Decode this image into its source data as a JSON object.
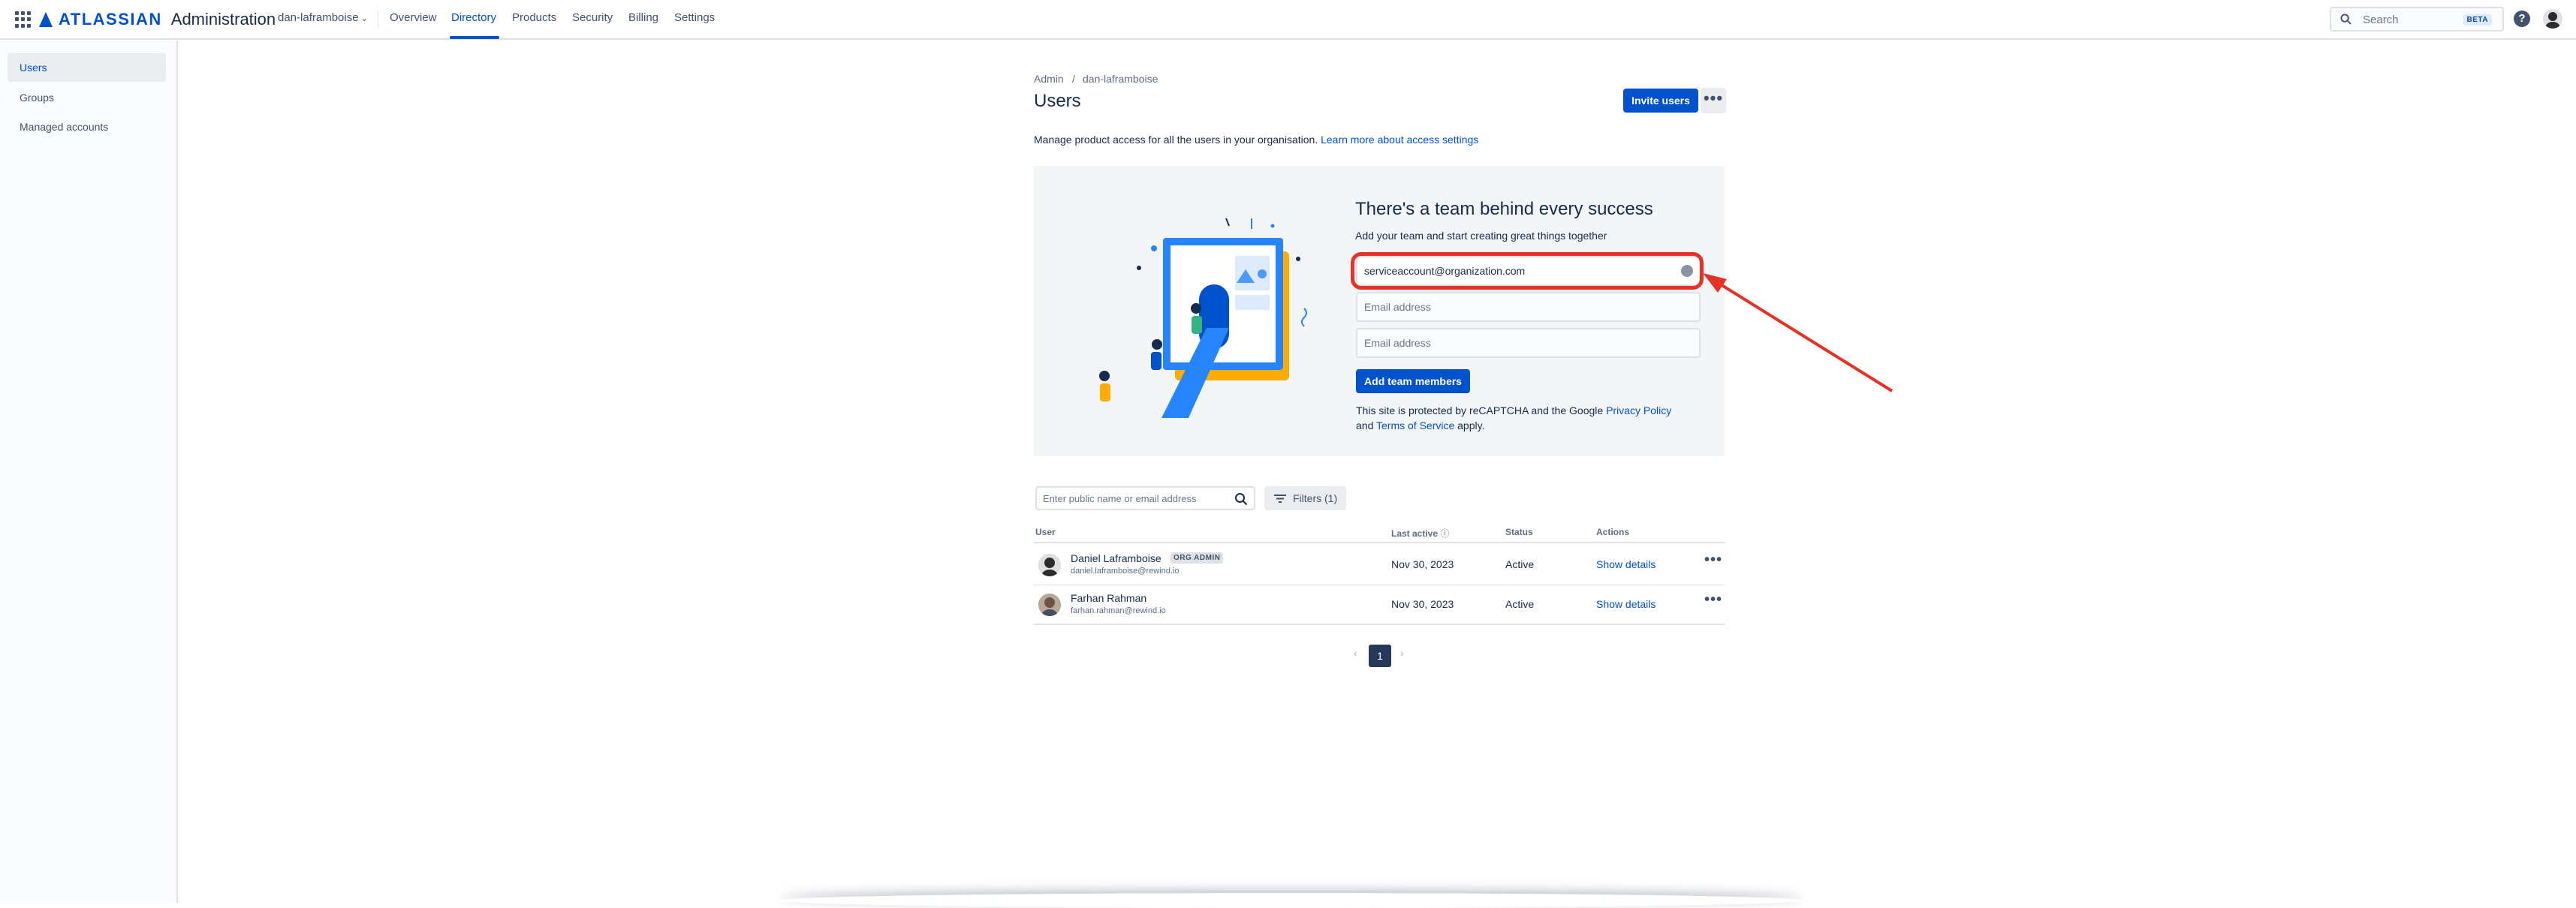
{
  "topnav": {
    "logo_word": "ATLASSIAN",
    "product": "Administration",
    "org_name": "dan-laframboise",
    "items": [
      "Overview",
      "Directory",
      "Products",
      "Security",
      "Billing",
      "Settings"
    ],
    "active_item": "Directory",
    "search_placeholder": "Search",
    "search_badge": "BETA",
    "help_glyph": "?"
  },
  "sidebar": {
    "items": [
      "Users",
      "Groups",
      "Managed accounts"
    ],
    "active": "Users"
  },
  "breadcrumb": [
    "Admin",
    "/",
    "dan-laframboise"
  ],
  "page": {
    "title": "Users",
    "invite_button": "Invite users",
    "more_glyph": "•••",
    "description": "Manage product access for all the users in your organisation.",
    "description_link": "Learn more about access settings"
  },
  "invite_panel": {
    "title": "There's a team behind every success",
    "subtitle": "Add your team and start creating great things together",
    "emails": [
      {
        "value": "serviceaccount@organization.com",
        "placeholder": ""
      },
      {
        "value": "",
        "placeholder": "Email address"
      },
      {
        "value": "",
        "placeholder": "Email address"
      }
    ],
    "add_button": "Add team members",
    "legal_1": "This site is protected by reCAPTCHA and the Google",
    "legal_link_1": "Privacy Policy",
    "legal_and": "and",
    "legal_link_2": "Terms of Service",
    "legal_2": "apply.",
    "highlight_color": "#e53226"
  },
  "filter_bar": {
    "search_placeholder": "Enter public name or email address",
    "filters_button": "Filters (1)"
  },
  "table": {
    "headers": [
      "User",
      "Last active",
      "Status",
      "Actions"
    ],
    "last_active_info": "ⓘ",
    "rows": [
      {
        "name": "Daniel Laframboise",
        "badge": "ORG ADMIN",
        "email": "daniel.laframboise@rewind.io",
        "last_active": "Nov 30, 2023",
        "status": "Active",
        "action": "Show details",
        "more": "•••"
      },
      {
        "name": "Farhan Rahman",
        "badge": "",
        "email": "farhan.rahman@rewind.io",
        "last_active": "Nov 30, 2023",
        "status": "Active",
        "action": "Show details",
        "more": "•••"
      }
    ]
  },
  "pagination": {
    "prev": "‹",
    "page": "1",
    "next": "›"
  },
  "colors": {
    "brand": "#0052cc",
    "highlight": "#e53226"
  }
}
